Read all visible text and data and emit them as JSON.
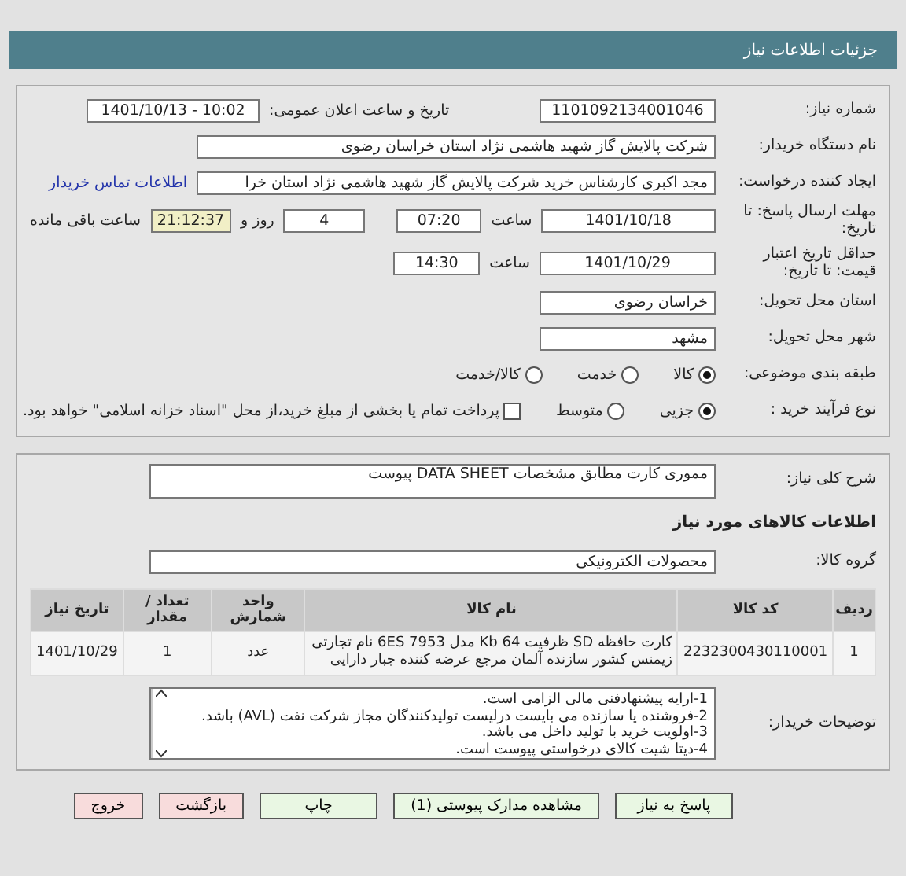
{
  "header": {
    "title": "جزئیات اطلاعات نیاز"
  },
  "need": {
    "number": {
      "label": "شماره نیاز:",
      "value": "1101092134001046"
    },
    "announce": {
      "label": "تاریخ و ساعت اعلان عمومی:",
      "value": "1401/10/13 - 10:02"
    },
    "buyer_org": {
      "label": "نام دستگاه خریدار:",
      "value": "شرکت پالایش گاز شهید هاشمی نژاد   استان خراسان رضوی"
    },
    "requester": {
      "label": "ایجاد کننده درخواست:",
      "value": "مجد اکبری کارشناس خرید شرکت پالایش گاز شهید هاشمی نژاد   استان خرا",
      "link": "اطلاعات تماس خریدار"
    },
    "deadline": {
      "label": "مهلت ارسال پاسخ: تا تاریخ:",
      "date": "1401/10/18",
      "time_label": "ساعت",
      "time": "07:20",
      "days": "4",
      "days_label": "روز و",
      "remaining": "21:12:37",
      "remaining_label": "ساعت باقی مانده"
    },
    "validity": {
      "label": "حداقل تاریخ اعتبار قیمت: تا تاریخ:",
      "date": "1401/10/29",
      "time_label": "ساعت",
      "time": "14:30"
    },
    "province": {
      "label": "استان محل تحویل:",
      "value": "خراسان رضوی"
    },
    "city": {
      "label": "شهر محل تحویل:",
      "value": "مشهد"
    },
    "category": {
      "label": "طبقه بندی موضوعی:",
      "options": [
        {
          "label": "کالا",
          "selected": true
        },
        {
          "label": "خدمت",
          "selected": false
        },
        {
          "label": "کالا/خدمت",
          "selected": false
        }
      ]
    },
    "process": {
      "label": "نوع فرآیند خرید :",
      "options": [
        {
          "label": "جزیی",
          "selected": true
        },
        {
          "label": "متوسط",
          "selected": false
        }
      ],
      "treasury": {
        "label": "پرداخت تمام یا بخشی از مبلغ خرید،از محل \"اسناد خزانه اسلامی\" خواهد بود.",
        "checked": false
      }
    }
  },
  "goods": {
    "description": {
      "label": "شرح کلی نیاز:",
      "value": "مموری کارت مطابق مشخصات DATA SHEET پیوست"
    },
    "section_title": "اطلاعات کالاهای مورد نیاز",
    "group": {
      "label": "گروه کالا:",
      "value": "محصولات الکترونیکی"
    },
    "table": {
      "columns": [
        "ردیف",
        "کد کالا",
        "نام کالا",
        "واحد شمارش",
        "تعداد / مقدار",
        "تاریخ نیاز"
      ],
      "rows": [
        [
          "1",
          "2232300430110001",
          "کارت حافظه SD ظرفیت 64 Kb مدل 6ES 7953 نام تجارتی زیمنس کشور سازنده آلمان مرجع عرضه کننده جبار دارایی",
          "عدد",
          "1",
          "1401/10/29"
        ]
      ]
    },
    "notes": {
      "label": "توضیحات خریدار:",
      "lines": [
        "1-ارایه پیشنهادفنی مالی الزامی است.",
        "2-فروشنده یا سازنده می بایست درلیست تولیدکنندگان مجاز شرکت نفت (AVL)  باشد.",
        "3-اولویت خرید با  تولید داخل می باشد.",
        "4-دیتا شیت کالای درخواستی پیوست است."
      ]
    }
  },
  "buttons": [
    {
      "label": "پاسخ به نیاز",
      "kind": "action"
    },
    {
      "label": "مشاهده مدارک پیوستی (1)",
      "kind": "action"
    },
    {
      "label": "چاپ",
      "kind": "action"
    },
    {
      "label": "بازگشت",
      "kind": "nav"
    },
    {
      "label": "خروج",
      "kind": "nav"
    }
  ]
}
